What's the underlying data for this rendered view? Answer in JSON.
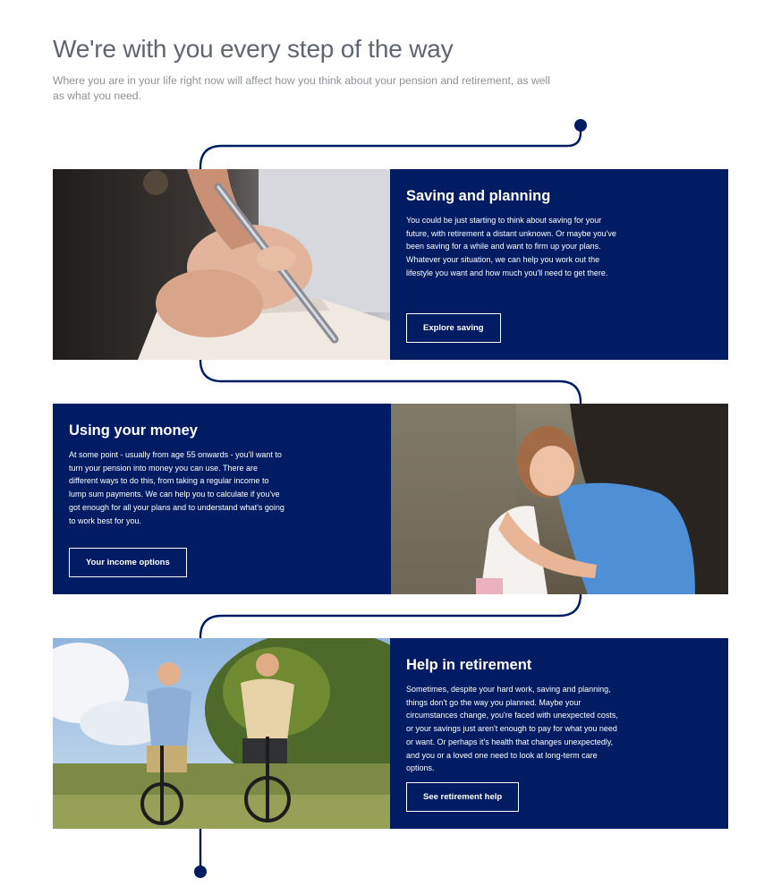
{
  "intro": {
    "title": "We're with you every step of the way",
    "subtitle": "Where you are in your life right now will affect how you think about your pension and retirement, as well as what you need."
  },
  "sections": [
    {
      "title": "Saving and planning",
      "body": "You could be just starting to think about saving for your future, with retirement a distant unknown. Or maybe you've been saving for a while and want to firm up your plans. Whatever your situation, we can help you work out the lifestyle you want and how much you'll need to get there.",
      "button": "Explore saving",
      "image": "hand-writing-with-pen-photo"
    },
    {
      "title": "Using your money",
      "body": "At some point - usually from age 55 onwards - you'll want to turn your pension into money you can use. There are different ways to do this, from taking a regular income to lump sum payments. We can help you to calculate if you've got enough for all your plans and to understand what's going to work best for you.",
      "button": "Your income options",
      "image": "child-hugging-adult-photo"
    },
    {
      "title": "Help in retirement",
      "body": "Sometimes, despite your hard work, saving and planning, things don't go the way you planned. Maybe your circumstances change, you're faced with unexpected costs, or your savings just aren't enough to pay for what you need or want. Or perhaps it's health that changes unexpectedly, and you or a loved one need to look at long-term care options.",
      "button": "See retirement help",
      "image": "older-couple-cycling-photo"
    }
  ],
  "colors": {
    "navy": "#021c63",
    "heading": "#5f6671",
    "subtext": "#8d929a"
  }
}
